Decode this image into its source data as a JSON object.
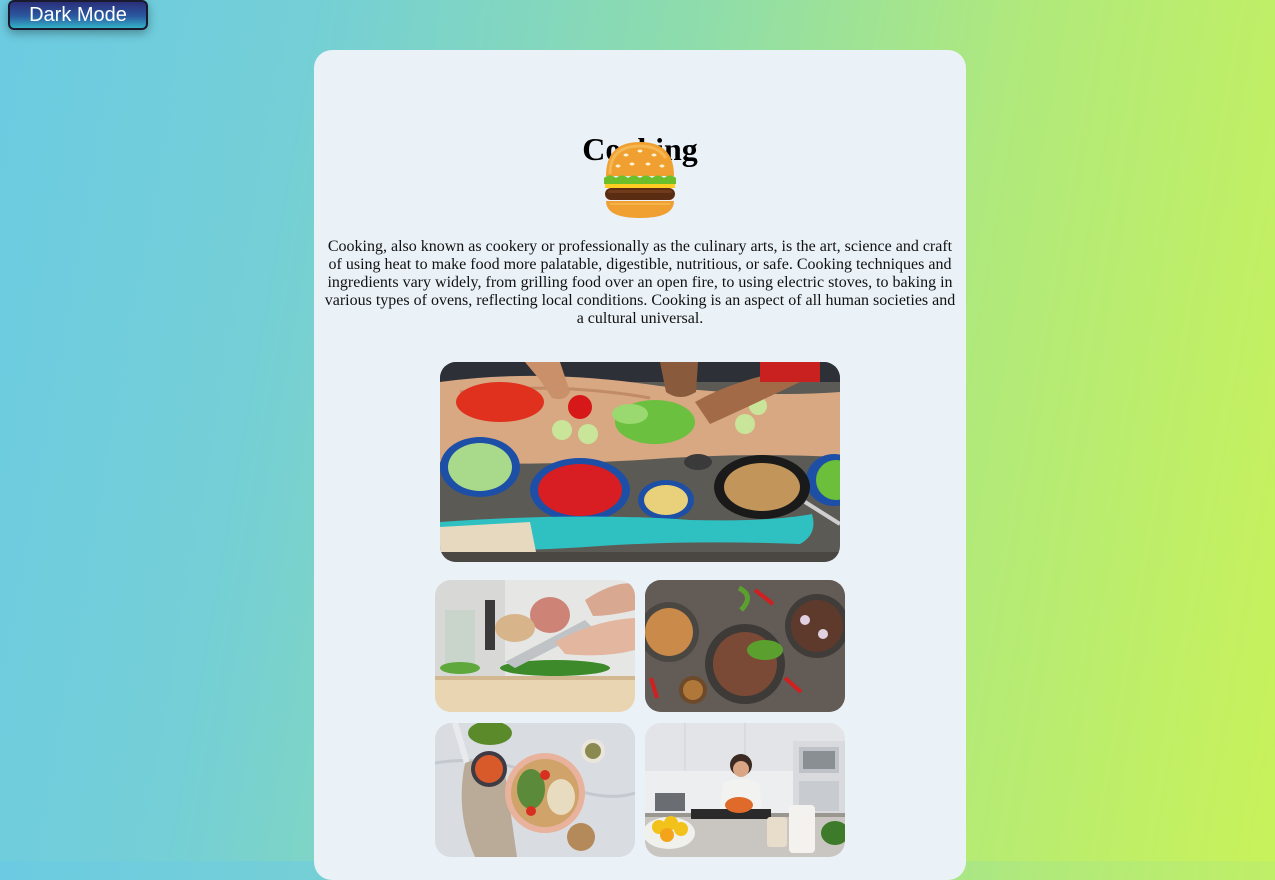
{
  "theme_toggle": {
    "label": "Dark Mode"
  },
  "page": {
    "title": "Cooking",
    "hero_icon": "hamburger-emoji-icon",
    "description": "Cooking, also known as cookery or professionally as the culinary arts, is the art, science and craft of using heat to make food more palatable, digestible, nutritious, or safe. Cooking techniques and ingredients vary widely, from grilling food over an open fire, to using electric stoves, to baking in various types of ovens, reflecting local conditions. Cooking is an aspect of all human societies and a cultural universal."
  },
  "gallery": {
    "photos": [
      {
        "subject": "people chopping vegetables on a wooden table"
      },
      {
        "subject": "hands chopping herbs with a knife"
      },
      {
        "subject": "plated dishes with meat and salad"
      },
      {
        "subject": "bowls of grains and vegetables on marble"
      },
      {
        "subject": "woman cooking in a modern kitchen"
      }
    ]
  },
  "colors": {
    "background_start": "#6ccbe2",
    "background_end": "#c9f25a",
    "card": "#eaf1f7",
    "toggle_top": "#2b2f7a",
    "toggle_bottom": "#33b2c7"
  }
}
